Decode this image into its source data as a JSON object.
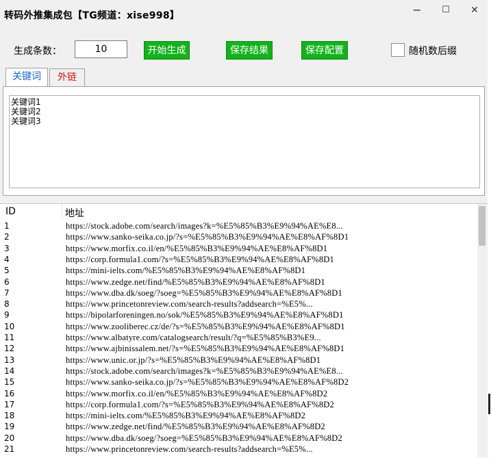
{
  "window": {
    "title": "转码外推集成包【TG频道：xise998】",
    "minimize": "−",
    "maximize": "☐",
    "close": "✕"
  },
  "controls": {
    "count_label": "生成条数：",
    "count_value": "10",
    "start_button": "开始生成",
    "save_result_button": "保存结果",
    "save_config_button": "保存配置",
    "random_suffix_label": "随机数后缀",
    "random_suffix_checked": false
  },
  "tabs": [
    {
      "label": "关键词",
      "active": true,
      "color": "#1565d8"
    },
    {
      "label": "外链",
      "active": false,
      "color": "#e0101a"
    }
  ],
  "keywords_text": [
    "关键词1",
    "关键词2",
    "关键词3"
  ],
  "table": {
    "columns": [
      "ID",
      "地址"
    ],
    "rows": [
      {
        "id": "1",
        "url": "https://stock.adobe.com/search/images?k=%E5%85%B3%E9%94%AE%E8..."
      },
      {
        "id": "2",
        "url": "https://www.sanko-seika.co.jp/?s=%E5%85%B3%E9%94%AE%E8%AF%8D1"
      },
      {
        "id": "3",
        "url": "https://www.morfix.co.il/en/%E5%85%B3%E9%94%AE%E8%AF%8D1"
      },
      {
        "id": "4",
        "url": "https://corp.formula1.com/?s=%E5%85%B3%E9%94%AE%E8%AF%8D1"
      },
      {
        "id": "5",
        "url": "https://mini-ielts.com/%E5%85%B3%E9%94%AE%E8%AF%8D1"
      },
      {
        "id": "6",
        "url": "https://www.zedge.net/find/%E5%85%B3%E9%94%AE%E8%AF%8D1"
      },
      {
        "id": "7",
        "url": "https://www.dba.dk/soeg/?soeg=%E5%85%B3%E9%94%AE%E8%AF%8D1"
      },
      {
        "id": "8",
        "url": "https://www.princetonreview.com/search-results?addsearch=%E5%..."
      },
      {
        "id": "9",
        "url": "https://bipolarforeningen.no/sok/%E5%85%B3%E9%94%AE%E8%AF%8D1"
      },
      {
        "id": "10",
        "url": "https://www.zooliberec.cz/de/?s=%E5%85%B3%E9%94%AE%E8%AF%8D1"
      },
      {
        "id": "11",
        "url": "https://www.albatyre.com/catalogsearch/result/?q=%E5%85%B3%E9..."
      },
      {
        "id": "12",
        "url": "https://www.ajbinissalem.net/?s=%E5%85%B3%E9%94%AE%E8%AF%8D1"
      },
      {
        "id": "13",
        "url": "https://www.unic.or.jp/?s=%E5%85%B3%E9%94%AE%E8%AF%8D1"
      },
      {
        "id": "14",
        "url": "https://stock.adobe.com/search/images?k=%E5%85%B3%E9%94%AE%E8..."
      },
      {
        "id": "15",
        "url": "https://www.sanko-seika.co.jp/?s=%E5%85%B3%E9%94%AE%E8%AF%8D2"
      },
      {
        "id": "16",
        "url": "https://www.morfix.co.il/en/%E5%85%B3%E9%94%AE%E8%AF%8D2"
      },
      {
        "id": "17",
        "url": "https://corp.formula1.com/?s=%E5%85%B3%E9%94%AE%E8%AF%8D2"
      },
      {
        "id": "18",
        "url": "https://mini-ielts.com/%E5%85%B3%E9%94%AE%E8%AF%8D2"
      },
      {
        "id": "19",
        "url": "https://www.zedge.net/find/%E5%85%B3%E9%94%AE%E8%AF%8D2"
      },
      {
        "id": "20",
        "url": "https://www.dba.dk/soeg/?soeg=%E5%85%B3%E9%94%AE%E8%AF%8D2"
      },
      {
        "id": "21",
        "url": "https://www.princetonreview.com/search-results?addsearch=%E5%..."
      }
    ]
  },
  "colors": {
    "button_green": "#14b21c",
    "tab_active_text": "#1565d8",
    "tab_inactive_text": "#e0101a"
  }
}
